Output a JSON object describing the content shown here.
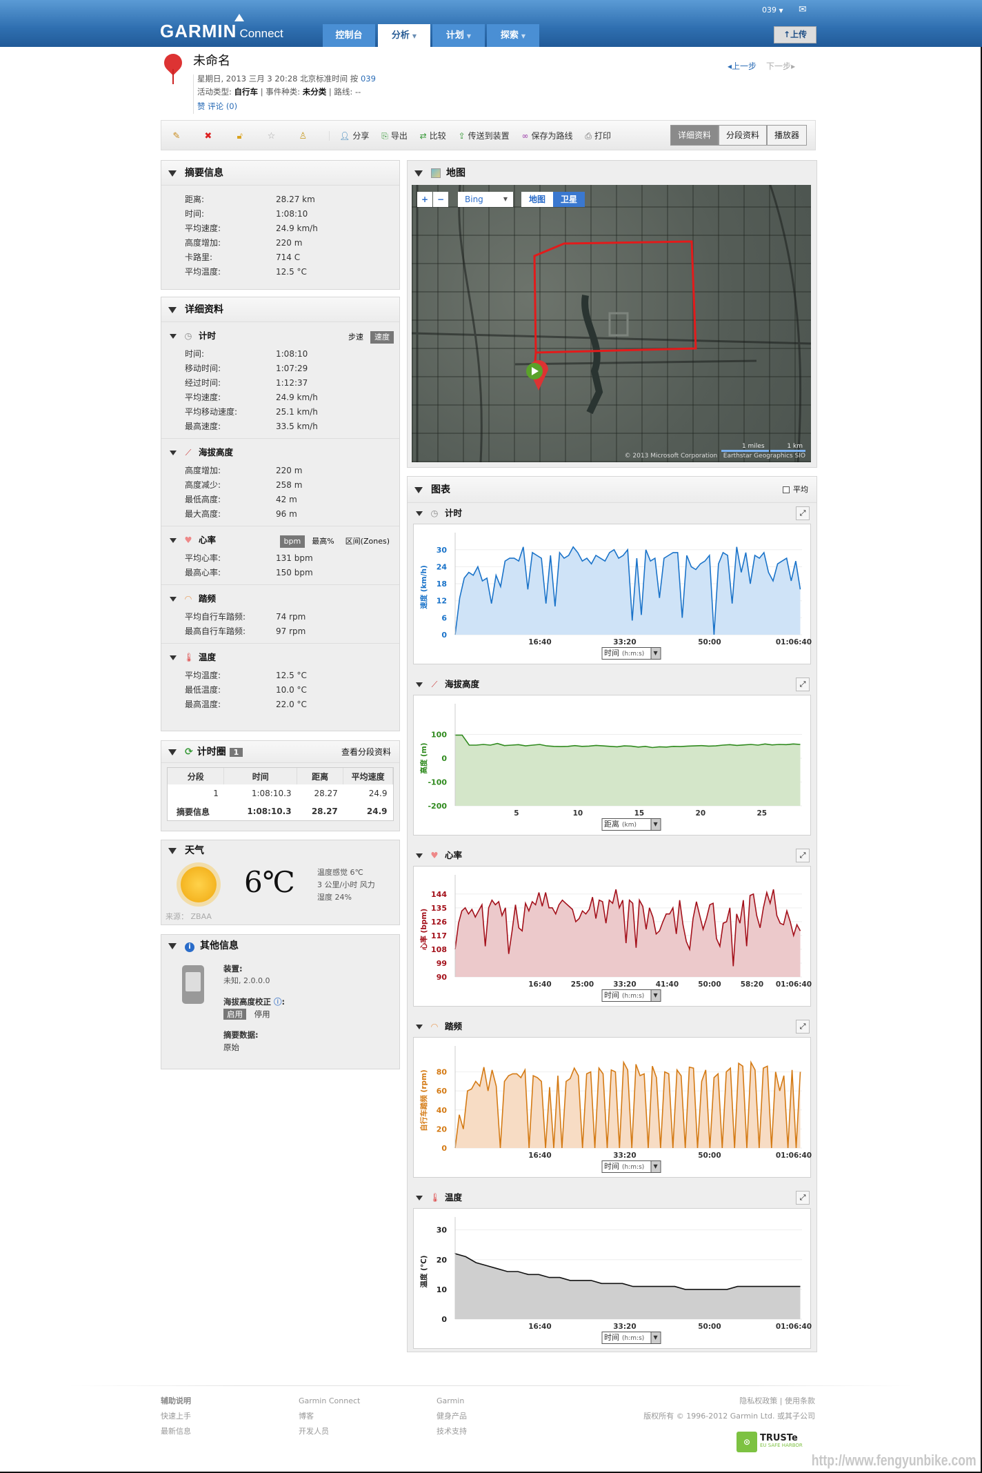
{
  "header": {
    "user": "039",
    "nav": [
      "控制台",
      "分析",
      "计划",
      "探索"
    ],
    "upload": "上传",
    "logo": "GARMIN",
    "logo_sub": "Connect"
  },
  "activity": {
    "title": "未命名",
    "date_line": "星期日, 2013 三月 3 20:28 北京标准时间 按",
    "owner": "039",
    "type_label": "活动类型:",
    "type": "自行车",
    "event_label": "| 事件种类:",
    "event": "未分类",
    "route_label": "| 路线:",
    "route": "--",
    "like": "赞",
    "comment": "评论",
    "comment_count": "(0)",
    "prev": "上一步",
    "next": "下一步"
  },
  "toolbar": {
    "actions": [
      "分享",
      "导出",
      "比较",
      "传送到装置",
      "保存为路线",
      "打印"
    ],
    "views": [
      "详细资料",
      "分段资料",
      "播放器"
    ]
  },
  "summary": {
    "title": "摘要信息",
    "rows": [
      {
        "label": "距离:",
        "value": "28.27 km"
      },
      {
        "label": "时间:",
        "value": "1:08:10"
      },
      {
        "label": "平均速度:",
        "value": "24.9 km/h"
      },
      {
        "label": "高度增加:",
        "value": "220 m"
      },
      {
        "label": "卡路里:",
        "value": "714 C"
      },
      {
        "label": "平均温度:",
        "value": "12.5 °C"
      }
    ]
  },
  "details": {
    "title": "详细资料",
    "sections": [
      {
        "title": "计时",
        "toggles": [
          "步速",
          "速度"
        ],
        "rows": [
          {
            "label": "时间:",
            "value": "1:08:10"
          },
          {
            "label": "移动时间:",
            "value": "1:07:29"
          },
          {
            "label": "经过时间:",
            "value": "1:12:37"
          },
          {
            "label": "平均速度:",
            "value": "24.9 km/h"
          },
          {
            "label": "平均移动速度:",
            "value": "25.1 km/h"
          },
          {
            "label": "最高速度:",
            "value": "33.5 km/h"
          }
        ]
      },
      {
        "title": "海拔高度",
        "toggles": [],
        "rows": [
          {
            "label": "高度增加:",
            "value": "220 m"
          },
          {
            "label": "高度减少:",
            "value": "258 m"
          },
          {
            "label": "最低高度:",
            "value": "42 m"
          },
          {
            "label": "最大高度:",
            "value": "96 m"
          }
        ]
      },
      {
        "title": "心率",
        "toggles": [
          "bpm",
          "最高%",
          "区间(Zones)"
        ],
        "rows": [
          {
            "label": "平均心率:",
            "value": "131 bpm"
          },
          {
            "label": "最高心率:",
            "value": "150 bpm"
          }
        ]
      },
      {
        "title": "踏频",
        "toggles": [],
        "rows": [
          {
            "label": "平均自行车踏频:",
            "value": "74 rpm"
          },
          {
            "label": "最高自行车踏频:",
            "value": "97 rpm"
          }
        ]
      },
      {
        "title": "温度",
        "toggles": [],
        "rows": [
          {
            "label": "平均温度:",
            "value": "12.5 °C"
          },
          {
            "label": "最低温度:",
            "value": "10.0 °C"
          },
          {
            "label": "最高温度:",
            "value": "22.0 °C"
          }
        ]
      }
    ]
  },
  "laps": {
    "title": "计时圈",
    "count": "1",
    "link": "查看分段资料",
    "headers": [
      "分段",
      "时间",
      "距离",
      "平均速度"
    ],
    "rows": [
      [
        "1",
        "1:08:10.3",
        "28.27",
        "24.9"
      ]
    ],
    "summary": [
      "摘要信息",
      "1:08:10.3",
      "28.27",
      "24.9"
    ]
  },
  "weather": {
    "title": "天气",
    "temp": "6℃",
    "feels": "温度感觉 6℃",
    "wind": "3 公里/小时 风力",
    "humidity": "湿度 24%",
    "source": "来源： ZBAA"
  },
  "other": {
    "title": "其他信息",
    "device_label": "装置:",
    "device": "未知, 2.0.0.0",
    "alt_label": "海拔高度校正",
    "enable": "启用",
    "disable": "停用",
    "summary_label": "摘要数据:",
    "summary": "原始"
  },
  "map": {
    "title": "地图",
    "provider": "Bing",
    "map_btn": "地图",
    "sat_btn": "卫星",
    "copyright": "© 2013 Microsoft Corporation   Earthstar Geographics SIO",
    "scale_miles": "1 miles",
    "scale_km": "1 km"
  },
  "charts": {
    "title": "图表",
    "avg_label": "平均"
  },
  "chart_data": [
    {
      "type": "area",
      "title": "计时",
      "ylabel": "速度 (km/h)",
      "xlabel": "时间",
      "xunit": "(h:m:s)",
      "color": "#1a73c9",
      "fill": "#cfe3f7",
      "xlim": [
        0,
        4090
      ],
      "ylim": [
        0,
        33.6
      ],
      "yticks": [
        0,
        6,
        12,
        18,
        24,
        30
      ],
      "xticks": [
        {
          "v": 1000,
          "label": "16:40"
        },
        {
          "v": 2000,
          "label": "33:20"
        },
        {
          "v": 3000,
          "label": "50:00"
        },
        {
          "v": 4000,
          "label": "01:06:40"
        }
      ],
      "values": [
        0,
        13,
        20,
        22,
        21,
        24,
        19,
        20,
        11,
        21,
        17,
        26,
        27,
        27,
        26,
        31,
        16,
        29,
        28,
        27,
        11,
        28,
        10,
        29,
        27,
        28,
        31,
        29,
        26,
        27,
        25,
        28,
        27,
        26,
        29,
        30,
        27,
        28,
        30,
        5,
        27,
        7,
        30,
        26,
        27,
        13,
        27,
        28,
        29,
        29,
        6,
        28,
        24,
        23,
        25,
        26,
        28,
        0,
        25,
        29,
        28,
        11,
        31,
        22,
        29,
        18,
        28,
        27,
        29,
        22,
        19,
        25,
        26,
        27,
        19,
        26,
        16
      ]
    },
    {
      "type": "area",
      "title": "海拔高度",
      "ylabel": "高度 (m)",
      "xlabel": "距离",
      "xunit": "(km)",
      "color": "#2f8a1e",
      "fill": "#d4e6c9",
      "xlim": [
        0,
        28.27
      ],
      "ylim": [
        -200,
        200
      ],
      "yticks": [
        -200,
        -100,
        0,
        100
      ],
      "xticks": [
        {
          "v": 5,
          "label": "5"
        },
        {
          "v": 10,
          "label": "10"
        },
        {
          "v": 15,
          "label": "15"
        },
        {
          "v": 20,
          "label": "20"
        },
        {
          "v": 25,
          "label": "25"
        }
      ],
      "values": [
        97,
        97,
        55,
        55,
        58,
        55,
        62,
        53,
        55,
        57,
        52,
        55,
        58,
        52,
        50,
        49,
        50,
        53,
        50,
        51,
        54,
        52,
        50,
        48,
        52,
        51,
        47,
        50,
        45,
        48,
        47,
        50,
        49,
        51,
        52,
        53,
        51,
        52,
        55,
        57,
        54,
        56,
        58,
        55,
        60,
        56,
        58,
        57,
        60,
        58
      ]
    },
    {
      "type": "area",
      "title": "心率",
      "ylabel": "心率 (bpm)",
      "xlabel": "时间",
      "xunit": "(h:m:s)",
      "color": "#a3101a",
      "fill": "#ecc9cb",
      "xlim": [
        0,
        4090
      ],
      "ylim": [
        90,
        152
      ],
      "yticks": [
        90,
        99,
        108,
        117,
        126,
        135,
        144
      ],
      "xticks": [
        {
          "v": 1000,
          "label": "16:40"
        },
        {
          "v": 1500,
          "label": "25:00"
        },
        {
          "v": 2000,
          "label": "33:20"
        },
        {
          "v": 2500,
          "label": "41:40"
        },
        {
          "v": 3000,
          "label": "50:00"
        },
        {
          "v": 3500,
          "label": "58:20"
        },
        {
          "v": 4000,
          "label": "01:06:40"
        }
      ],
      "values": [
        108,
        125,
        133,
        135,
        131,
        134,
        129,
        133,
        137,
        110,
        135,
        140,
        137,
        139,
        130,
        135,
        105,
        120,
        137,
        122,
        120,
        138,
        133,
        139,
        137,
        145,
        136,
        145,
        135,
        135,
        131,
        137,
        140,
        138,
        136,
        134,
        126,
        128,
        133,
        131,
        134,
        142,
        128,
        140,
        139,
        125,
        140,
        138,
        147,
        135,
        140,
        112,
        140,
        138,
        109,
        140,
        136,
        121,
        135,
        129,
        118,
        120,
        126,
        131,
        131,
        135,
        118,
        140,
        124,
        113,
        108,
        128,
        139,
        130,
        121,
        128,
        137,
        138,
        115,
        110,
        125,
        126,
        135,
        97,
        131,
        125,
        140,
        110,
        143,
        144,
        130,
        122,
        135,
        145,
        138,
        147,
        130,
        125,
        124,
        133,
        126,
        117,
        124,
        120
      ]
    },
    {
      "type": "area",
      "title": "踏频",
      "ylabel": "自行车踏频 (rpm)",
      "xlabel": "时间",
      "xunit": "(h:m:s)",
      "color": "#d47a14",
      "fill": "#f7dcc4",
      "xlim": [
        0,
        4090
      ],
      "ylim": [
        0,
        100
      ],
      "yticks": [
        0,
        20,
        40,
        60,
        80
      ],
      "xticks": [
        {
          "v": 1000,
          "label": "16:40"
        },
        {
          "v": 2000,
          "label": "33:20"
        },
        {
          "v": 3000,
          "label": "50:00"
        },
        {
          "v": 4000,
          "label": "01:06:40"
        }
      ],
      "values": [
        0,
        35,
        20,
        60,
        62,
        70,
        65,
        85,
        60,
        82,
        65,
        0,
        70,
        76,
        78,
        78,
        74,
        82,
        0,
        76,
        74,
        70,
        0,
        64,
        0,
        76,
        0,
        70,
        73,
        84,
        76,
        0,
        78,
        80,
        0,
        84,
        78,
        0,
        82,
        80,
        0,
        90,
        82,
        0,
        88,
        76,
        78,
        0,
        86,
        74,
        0,
        80,
        78,
        0,
        82,
        76,
        0,
        85,
        84,
        0,
        70,
        82,
        0,
        74,
        78,
        0,
        80,
        84,
        0,
        89,
        86,
        0,
        90,
        82,
        0,
        84,
        86,
        0,
        80,
        60,
        76,
        0,
        82,
        0,
        80
      ]
    },
    {
      "type": "area",
      "title": "温度",
      "ylabel": "温度 (°C)",
      "xlabel": "时间",
      "xunit": "(h:m:s)",
      "color": "#111111",
      "fill": "#cfcfcf",
      "xlim": [
        0,
        4090
      ],
      "ylim": [
        0,
        32
      ],
      "yticks": [
        0,
        10,
        20,
        30
      ],
      "xticks": [
        {
          "v": 1000,
          "label": "16:40"
        },
        {
          "v": 2000,
          "label": "33:20"
        },
        {
          "v": 3000,
          "label": "50:00"
        },
        {
          "v": 4000,
          "label": "01:06:40"
        }
      ],
      "values": [
        22,
        21,
        19,
        18,
        17,
        16,
        16,
        15,
        15,
        14,
        14,
        13,
        13,
        13,
        12,
        12,
        12,
        11,
        11,
        11,
        11,
        11,
        10,
        10,
        10,
        10,
        10,
        11,
        11,
        11,
        11,
        11,
        11,
        11
      ]
    }
  ],
  "footer": {
    "cols": [
      {
        "title": "辅助说明",
        "links": [
          "快速上手",
          "最新信息"
        ]
      },
      {
        "title": "Garmin Connect",
        "links": [
          "博客",
          "开发人员"
        ]
      },
      {
        "title": "Garmin",
        "links": [
          "健身产品",
          "技术支持"
        ]
      }
    ],
    "privacy": "隐私权政策",
    "terms": "使用条款",
    "copyright": "版权所有 © 1996-2012 Garmin Ltd. 或其子公司",
    "truste": "TRUSTe",
    "truste_sub": "EU SAFE HARBOR",
    "watermark": "http://www.fengyunbike.com"
  }
}
